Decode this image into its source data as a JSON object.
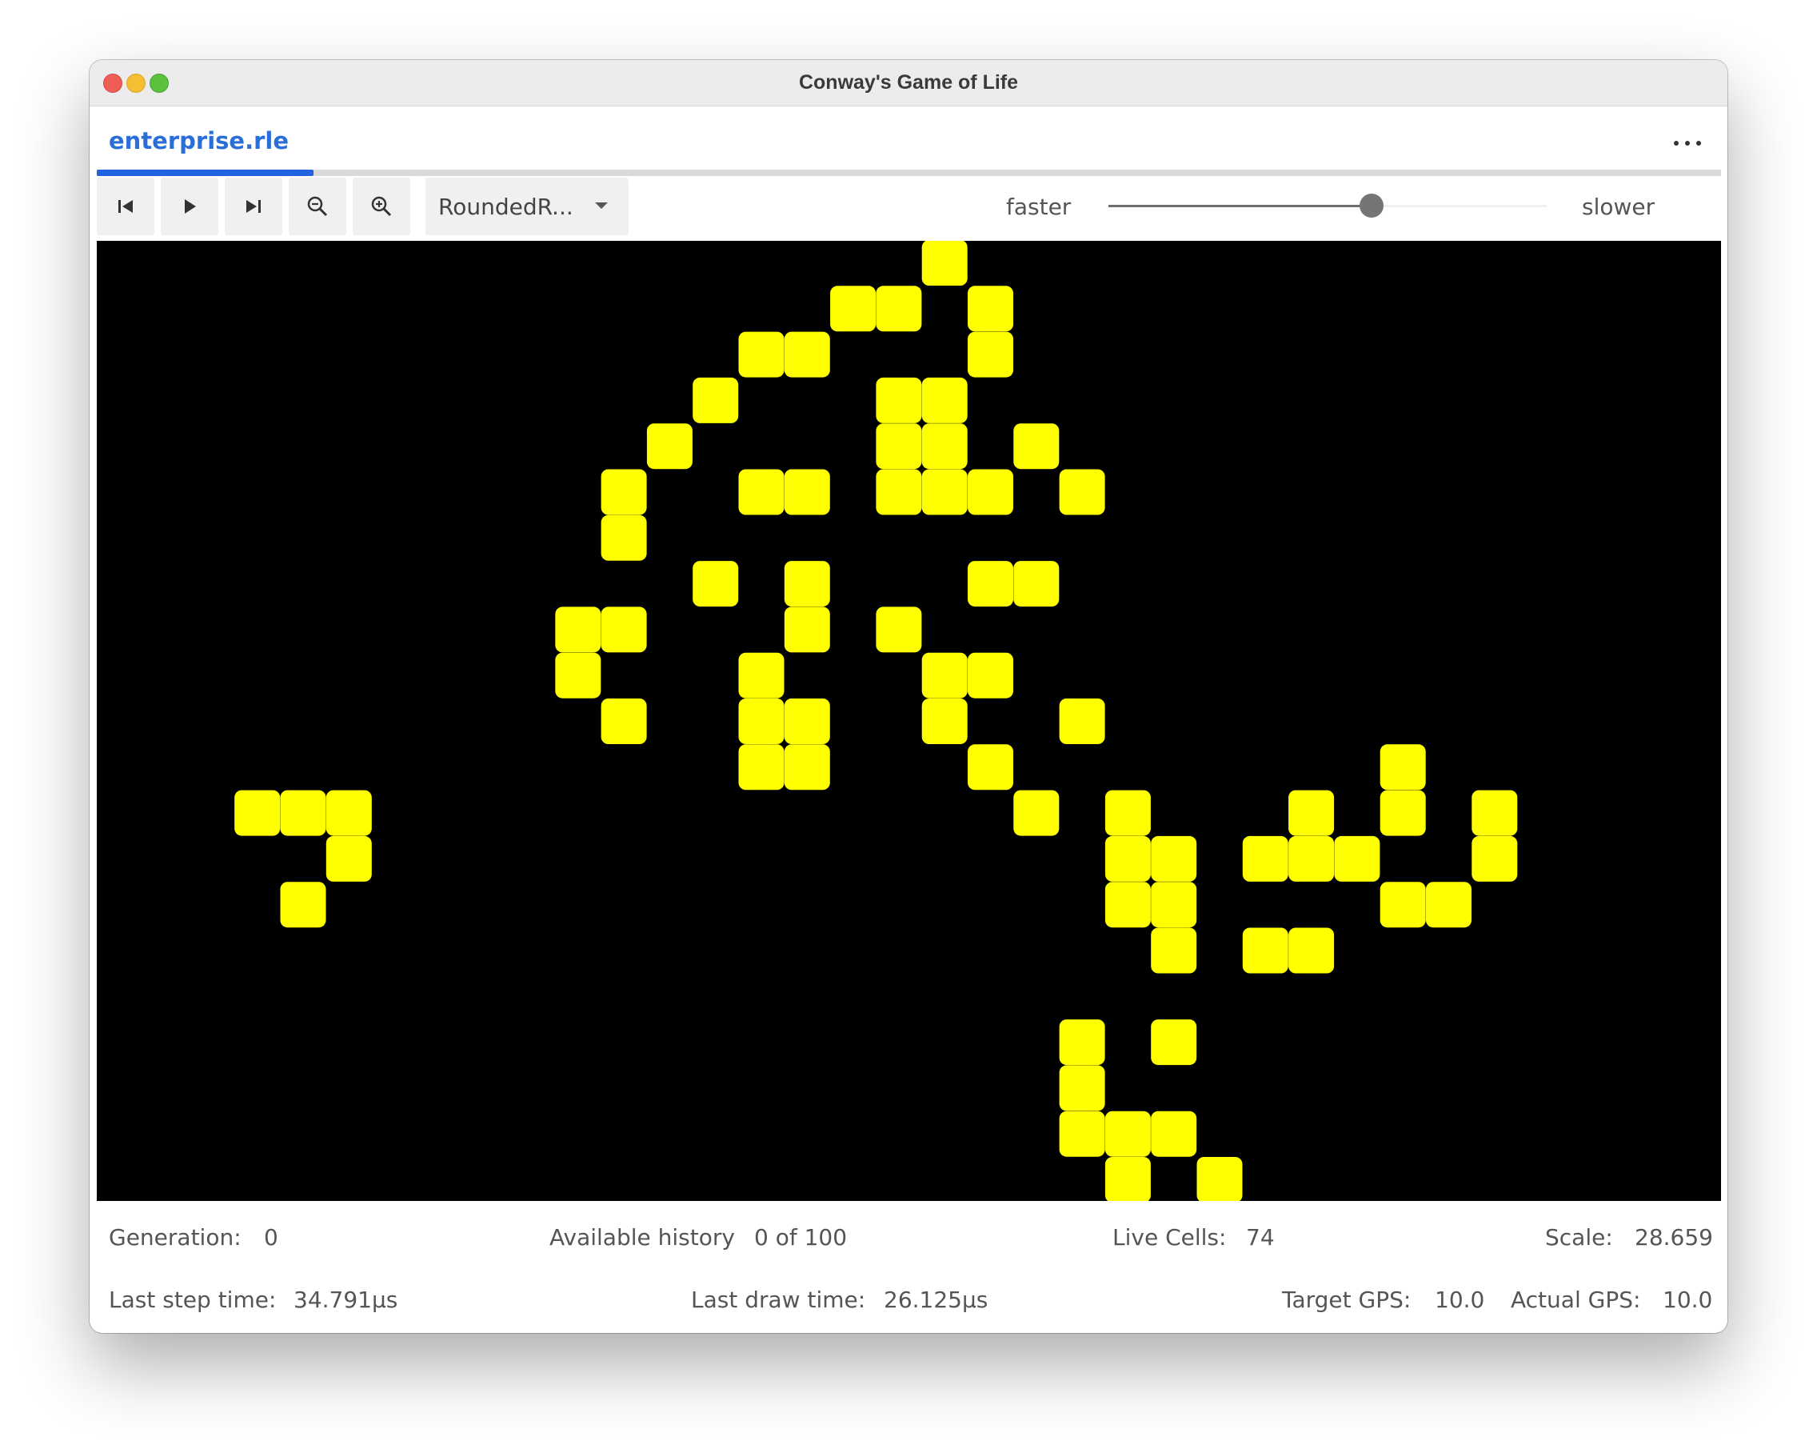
{
  "window": {
    "title": "Conway's Game of Life"
  },
  "tab": {
    "label": "enterprise.rle",
    "menu_icon": "more-horizontal-icon"
  },
  "toolbar": {
    "buttons": [
      {
        "icon": "skip-to-start-icon"
      },
      {
        "icon": "play-icon"
      },
      {
        "icon": "step-forward-icon"
      },
      {
        "icon": "zoom-out-icon"
      },
      {
        "icon": "zoom-in-icon"
      }
    ],
    "renderer_select": "RoundedR...",
    "speed_left_label": "faster",
    "speed_right_label": "slower",
    "speed_slider_fraction": 0.6
  },
  "board": {
    "background": "#000000",
    "cell_color": "#ffff00",
    "cells": [
      [
        18,
        0
      ],
      [
        16,
        1
      ],
      [
        17,
        1
      ],
      [
        19,
        1
      ],
      [
        14,
        2
      ],
      [
        15,
        2
      ],
      [
        19,
        2
      ],
      [
        13,
        3
      ],
      [
        17,
        3
      ],
      [
        18,
        3
      ],
      [
        12,
        4
      ],
      [
        17,
        4
      ],
      [
        18,
        4
      ],
      [
        20,
        4
      ],
      [
        11,
        5
      ],
      [
        14,
        5
      ],
      [
        15,
        5
      ],
      [
        17,
        5
      ],
      [
        18,
        5
      ],
      [
        19,
        5
      ],
      [
        21,
        5
      ],
      [
        11,
        6
      ],
      [
        13,
        7
      ],
      [
        15,
        7
      ],
      [
        19,
        7
      ],
      [
        20,
        7
      ],
      [
        10,
        8
      ],
      [
        11,
        8
      ],
      [
        15,
        8
      ],
      [
        17,
        8
      ],
      [
        10,
        9
      ],
      [
        14,
        9
      ],
      [
        18,
        9
      ],
      [
        19,
        9
      ],
      [
        11,
        10
      ],
      [
        14,
        10
      ],
      [
        15,
        10
      ],
      [
        18,
        10
      ],
      [
        21,
        10
      ],
      [
        14,
        11
      ],
      [
        15,
        11
      ],
      [
        19,
        11
      ],
      [
        28,
        11
      ],
      [
        3,
        12
      ],
      [
        4,
        12
      ],
      [
        5,
        12
      ],
      [
        20,
        12
      ],
      [
        22,
        12
      ],
      [
        26,
        12
      ],
      [
        28,
        12
      ],
      [
        30,
        12
      ],
      [
        5,
        13
      ],
      [
        22,
        13
      ],
      [
        23,
        13
      ],
      [
        25,
        13
      ],
      [
        26,
        13
      ],
      [
        27,
        13
      ],
      [
        30,
        13
      ],
      [
        4,
        14
      ],
      [
        22,
        14
      ],
      [
        23,
        14
      ],
      [
        28,
        14
      ],
      [
        29,
        14
      ],
      [
        23,
        15
      ],
      [
        25,
        15
      ],
      [
        26,
        15
      ],
      [
        21,
        17
      ],
      [
        23,
        17
      ],
      [
        21,
        18
      ],
      [
        21,
        19
      ],
      [
        22,
        19
      ],
      [
        23,
        19
      ],
      [
        22,
        20
      ],
      [
        24,
        20
      ]
    ]
  },
  "stats": {
    "generation_label": "Generation:",
    "generation_value": "0",
    "history_label": "Available history",
    "history_value": "0 of 100",
    "live_cells_label": "Live Cells:",
    "live_cells_value": "74",
    "scale_label": "Scale:",
    "scale_value": "28.659",
    "step_time_label": "Last step time:",
    "step_time_value": "34.791µs",
    "draw_time_label": "Last draw time:",
    "draw_time_value": "26.125µs",
    "target_gps_label": "Target GPS:",
    "target_gps_value": "10.0",
    "actual_gps_label": "Actual GPS:",
    "actual_gps_value": "10.0"
  }
}
